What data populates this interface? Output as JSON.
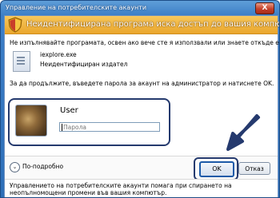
{
  "window": {
    "title": "Управление на потребителските акаунти",
    "close_label": "X"
  },
  "banner": {
    "text": "Неидентифицирана програма иска достъп до вашия компютър"
  },
  "info": "Не изпълнявайте програмата, освен ако вече сте я използвали или знаете откъде е.",
  "program": {
    "name": "iexplore.exe",
    "publisher": "Неидентифициран издател"
  },
  "continue_text": "За да продължите, въведете парола за акаунт на администратор и натиснете OK.",
  "user": {
    "name": "User",
    "password_placeholder": "Парола"
  },
  "footer": {
    "details_label": "По-подробно",
    "ok_label": "OK",
    "cancel_label": "Отказ",
    "bottom_text": "Управлението на потребителските акаунти помага при спирането на неопълномощени промени във вашия компютър."
  },
  "colors": {
    "banner": "#eaa62c",
    "title_bar": "#3d7fc7",
    "annotation": "#253a6e"
  }
}
